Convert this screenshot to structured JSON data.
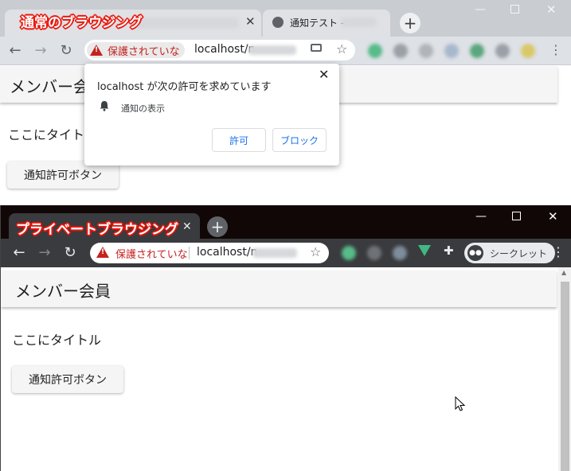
{
  "captions": {
    "normal": "通常のブラウジング",
    "private": "プライベートブラウジング"
  },
  "normal_browser": {
    "tab2_title": "通知テスト -",
    "security_label": "保護されていな",
    "url": "localhost/n",
    "page": {
      "appbar_title": "メンバー会",
      "heading": "ここにタイト",
      "button_label": "通知許可ボタン"
    },
    "popup": {
      "message": "localhost が次の許可を求めています",
      "permission": "通知の表示",
      "allow_label": "許可",
      "block_label": "ブロック"
    }
  },
  "private_browser": {
    "security_label": "保護されていな",
    "url": "localhost/n",
    "incognito_label": "シークレット",
    "page": {
      "appbar_title": "メンバー会員",
      "heading": "ここにタイトル",
      "button_label": "通知許可ボタン"
    }
  },
  "colors": {
    "caption_outline": "#e8190e",
    "security_red": "#c5221f",
    "private_frame": "#120707",
    "link_blue": "#1a73e8"
  },
  "icons": {
    "new_tab": "plus-icon",
    "close_tab": "close-icon",
    "back": "arrow-left-icon",
    "forward": "arrow-right-icon",
    "reload": "reload-icon",
    "bookmark": "star-icon",
    "menu": "kebab-menu-icon",
    "permission": "bell-icon",
    "extensions": "puzzle-icon",
    "incognito": "incognito-icon"
  }
}
